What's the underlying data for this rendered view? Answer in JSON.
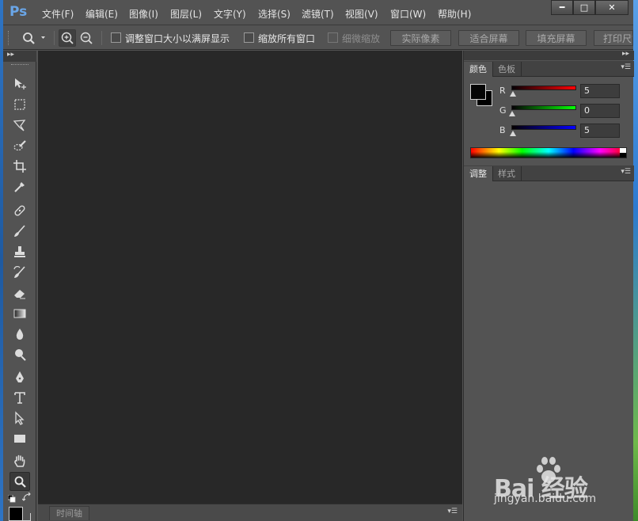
{
  "app": {
    "logo": "Ps"
  },
  "menubar": {
    "items": [
      "文件(F)",
      "编辑(E)",
      "图像(I)",
      "图层(L)",
      "文字(Y)",
      "选择(S)",
      "滤镜(T)",
      "视图(V)",
      "窗口(W)",
      "帮助(H)"
    ]
  },
  "window_controls": {
    "minimize": "━",
    "maximize": "□",
    "close": "✕"
  },
  "options": {
    "resize_windows_label": "调整窗口大小以满屏显示",
    "zoom_all_label": "缩放所有窗口",
    "scrubby_label": "细微缩放",
    "actual_pixels": "实际像素",
    "fit_screen": "适合屏幕",
    "fill_screen": "填充屏幕",
    "print_size": "打印尺寸"
  },
  "timeline": {
    "tab": "时间轴"
  },
  "panels": {
    "color_tabs": [
      "颜色",
      "色板"
    ],
    "channels": [
      {
        "label": "R",
        "value": "5",
        "color": "#ff0000"
      },
      {
        "label": "G",
        "value": "0",
        "color": "#00ff00"
      },
      {
        "label": "B",
        "value": "5",
        "color": "#0000ff"
      }
    ],
    "adjust_tabs": [
      "调整",
      "样式"
    ]
  },
  "watermark": {
    "brand": "Bai  经验",
    "url": "jingyan.baidu.com"
  }
}
